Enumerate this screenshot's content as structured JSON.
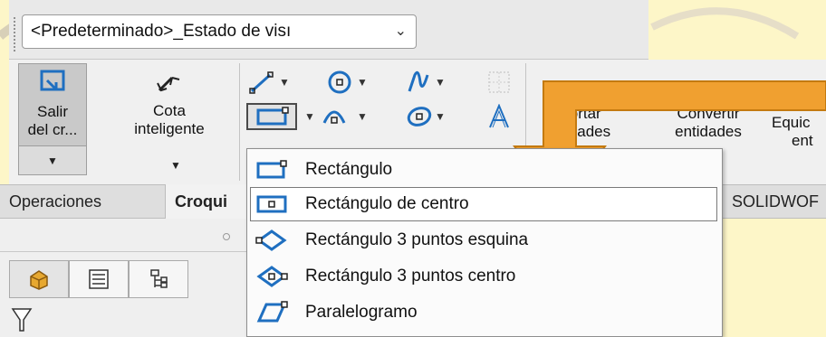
{
  "config": {
    "selected": "<Predeterminado>_Estado de visı"
  },
  "ribbon": {
    "exit_line1": "Salir",
    "exit_line2": "del cr...",
    "smart_dim_line1": "Cota",
    "smart_dim_line2": "inteligente",
    "trim_line1": "cortar",
    "trim_line2": "e  idades",
    "convert_line1": "Convertir",
    "convert_line2": "entidades",
    "offset_line1": "Equic",
    "offset_line2": "ent"
  },
  "tabs": {
    "ops": "Operaciones",
    "sketch": "Croqui",
    "solidworks": "SOLIDWOF"
  },
  "menu": {
    "items": [
      {
        "label": "Rectángulo",
        "icon": "corner-rectangle-icon"
      },
      {
        "label": "Rectángulo de centro",
        "icon": "center-rectangle-icon"
      },
      {
        "label": "Rectángulo 3 puntos esquina",
        "icon": "3-point-corner-rectangle-icon"
      },
      {
        "label": "Rectángulo 3 puntos centro",
        "icon": "3-point-center-rectangle-icon"
      },
      {
        "label": "Paralelogramo",
        "icon": "parallelogram-icon"
      }
    ]
  },
  "colors": {
    "accent_orange": "#f0a030",
    "highlight_blue": "#1f6fc0",
    "background": "#fdf6c8"
  }
}
